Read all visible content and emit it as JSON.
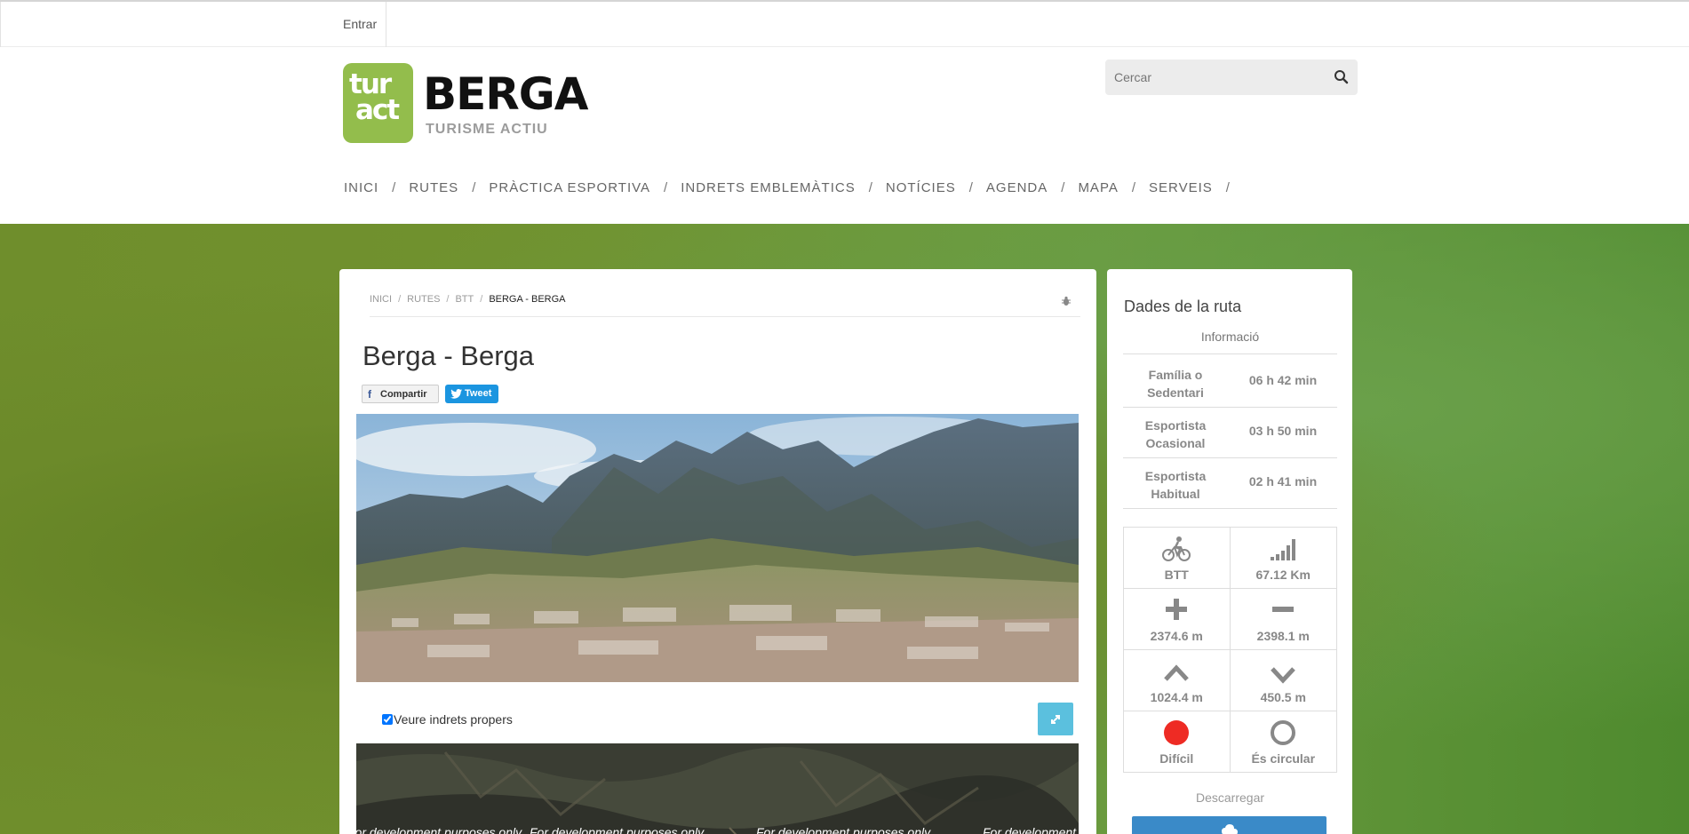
{
  "topbar": {
    "login_label": "Entrar"
  },
  "logo": {
    "box_line1": "tur",
    "box_line2": "act",
    "name": "BERGA",
    "subtitle": "TURISME ACTIU",
    "brand_color": "#93bd4c"
  },
  "search": {
    "placeholder": "Cercar"
  },
  "nav": [
    {
      "label": "INICI"
    },
    {
      "label": "RUTES"
    },
    {
      "label": "PRÀCTICA ESPORTIVA"
    },
    {
      "label": "INDRETS EMBLEMÀTICS"
    },
    {
      "label": "NOTÍCIES"
    },
    {
      "label": "AGENDA"
    },
    {
      "label": "MAPA"
    },
    {
      "label": "SERVEIS"
    }
  ],
  "nav_separator": "/",
  "breadcrumb": {
    "items": [
      "INICI",
      "RUTES",
      "BTT"
    ],
    "current": "BERGA - BERGA",
    "separator": "/"
  },
  "route": {
    "title": "Berga - Berga",
    "share_facebook": "Compartir",
    "share_twitter": "Tweet",
    "nearby_label": "Veure indrets propers",
    "map_watermark": "For development purposes only"
  },
  "sidebar": {
    "title": "Dades de la ruta",
    "subtitle": "Informació",
    "times": [
      {
        "label": "Família o Sedentari",
        "value": "06 h 42 min"
      },
      {
        "label": "Esportista Ocasional",
        "value": "03 h 50 min"
      },
      {
        "label": "Esportista Habitual",
        "value": "02 h 41 min"
      }
    ],
    "stats": {
      "type": "BTT",
      "distance": "67.12 Km",
      "ascent": "2374.6 m",
      "descent": "2398.1 m",
      "max_altitude": "1024.4 m",
      "min_altitude": "450.5 m",
      "difficulty": "Difícil",
      "circular": "És circular"
    },
    "difficulty_color": "#ee2b24",
    "download_label": "Descarregar",
    "download_button_color": "#3a8ac8"
  }
}
